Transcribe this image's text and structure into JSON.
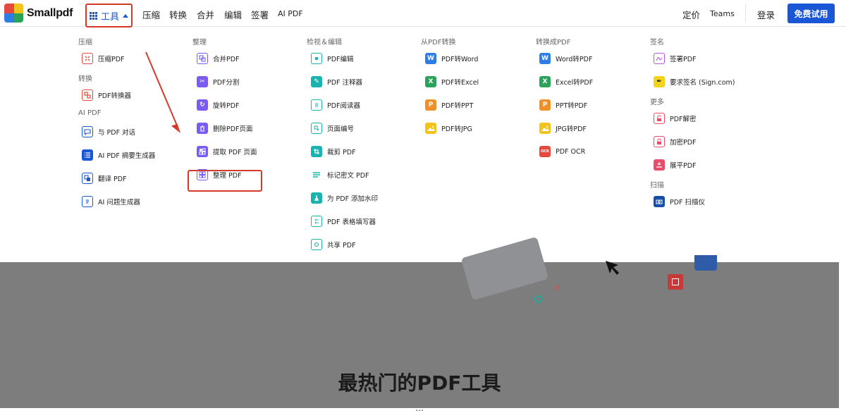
{
  "brand": {
    "name": "Smallpdf"
  },
  "nav": {
    "tools": "工具",
    "compress": "压缩",
    "convert": "转换",
    "merge": "合并",
    "edit": "编辑",
    "sign": "签署",
    "ai": "AI PDF",
    "pricing": "定价",
    "teams": "Teams",
    "login": "登录",
    "cta": "免费试用"
  },
  "menu": {
    "col1": {
      "sections": [
        {
          "title": "压缩",
          "items": [
            {
              "label": "压缩PDF",
              "icon": "compress-icon"
            }
          ]
        },
        {
          "title": "转换",
          "items": [
            {
              "label": "PDF转换器",
              "icon": "convert-icon"
            }
          ]
        },
        {
          "title": "AI PDF",
          "items": [
            {
              "label": "与 PDF 对话",
              "icon": "chat-icon"
            },
            {
              "label": "AI PDF 摘要生成器",
              "icon": "list-icon"
            },
            {
              "label": "翻译 PDF",
              "icon": "translate-icon"
            },
            {
              "label": "AI 问题生成器",
              "icon": "doc-icon"
            }
          ]
        }
      ]
    },
    "col2": {
      "title": "整理",
      "items": [
        {
          "label": "合并PDF",
          "icon": "merge-icon"
        },
        {
          "label": "PDF分割",
          "icon": "scissors-icon"
        },
        {
          "label": "旋转PDF",
          "icon": "rotate-icon"
        },
        {
          "label": "删除PDF页面",
          "icon": "trash-icon"
        },
        {
          "label": "提取 PDF 页面",
          "icon": "extract-icon"
        },
        {
          "label": "整理 PDF",
          "icon": "grid-icon"
        }
      ]
    },
    "col3": {
      "title": "检视＆编辑",
      "items": [
        {
          "label": "PDF编辑",
          "icon": "edit-icon"
        },
        {
          "label": "PDF 注释器",
          "icon": "pen-icon"
        },
        {
          "label": "PDF阅读器",
          "icon": "reader-icon"
        },
        {
          "label": "页面编号",
          "icon": "number-icon"
        },
        {
          "label": "裁剪 PDF",
          "icon": "crop-icon"
        },
        {
          "label": "标记密文 PDF",
          "icon": "redact-icon"
        },
        {
          "label": "为 PDF 添加水印",
          "icon": "watermark-icon"
        },
        {
          "label": "PDF 表格填写器",
          "icon": "form-icon"
        },
        {
          "label": "共享 PDF",
          "icon": "share-icon"
        }
      ]
    },
    "col4": {
      "title": "从PDF转换",
      "items": [
        {
          "label": "PDF转Word",
          "icon": "word-icon"
        },
        {
          "label": "PDF转Excel",
          "icon": "excel-icon"
        },
        {
          "label": "PDF转PPT",
          "icon": "ppt-icon"
        },
        {
          "label": "PDF转JPG",
          "icon": "jpg-icon"
        }
      ]
    },
    "col5": {
      "title": "转换成PDF",
      "items": [
        {
          "label": "Word转PDF",
          "icon": "word-icon"
        },
        {
          "label": "Excel转PDF",
          "icon": "excel-icon"
        },
        {
          "label": "PPT转PDF",
          "icon": "ppt-icon"
        },
        {
          "label": "JPG转PDF",
          "icon": "jpg-icon"
        },
        {
          "label": "PDF OCR",
          "icon": "ocr-icon"
        }
      ]
    },
    "col6": {
      "sections": [
        {
          "title": "签名",
          "items": [
            {
              "label": "签署PDF",
              "icon": "signature-icon"
            },
            {
              "label": "要求签名 (Sign.com)",
              "icon": "sign-pen-icon"
            }
          ]
        },
        {
          "title": "更多",
          "items": [
            {
              "label": "PDF解密",
              "icon": "unlock-icon"
            },
            {
              "label": "加密PDF",
              "icon": "lock-icon"
            },
            {
              "label": "展平PDF",
              "icon": "flatten-icon"
            }
          ]
        },
        {
          "title": "扫描",
          "items": [
            {
              "label": "PDF 扫描仪",
              "icon": "camera-icon"
            }
          ]
        }
      ]
    }
  },
  "hero": {
    "title": "最热门的PDF工具",
    "subtitle": "…"
  },
  "colors": {
    "primary": "#1a57d6",
    "highlight": "#d33a2a",
    "red": "#e5483c",
    "purple": "#7a5cf0",
    "teal": "#1ab3b0",
    "word": "#2e7de6",
    "excel": "#29a35a",
    "ppt": "#f0902b",
    "jpg": "#f2c31a",
    "pink": "#e94b6a",
    "violet": "#b25ad6"
  }
}
